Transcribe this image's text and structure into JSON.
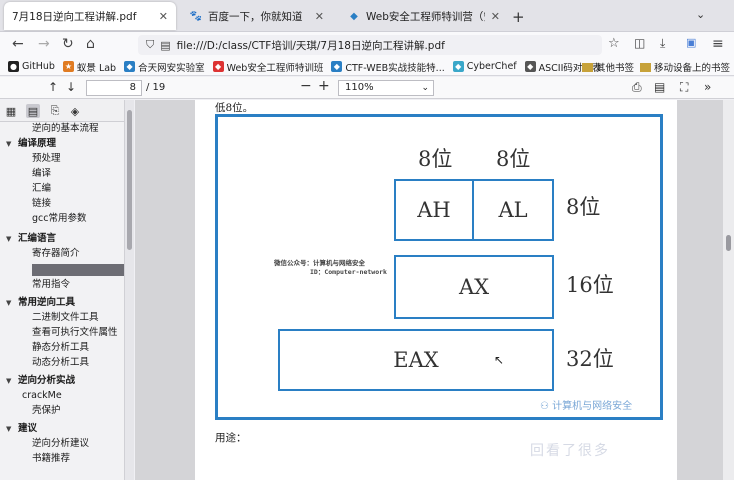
{
  "tabs": [
    {
      "title": "7月18日逆向工程讲解.pdf",
      "active": true
    },
    {
      "title": "百度一下，你就知道",
      "active": false
    },
    {
      "title": "Web安全工程师特训营（安全",
      "active": false
    }
  ],
  "nav": {
    "url": "file:///D:/class/CTF培训/天琪/7月18日逆向工程讲解.pdf"
  },
  "bookmarks": [
    "GitHub",
    "蚁景 Lab",
    "合天网安实验室",
    "Web安全工程师特训班",
    "CTF-WEB实战技能特...",
    "CyberChef",
    "ASCII码对照表"
  ],
  "bookmarks_right": [
    "其他书签",
    "移动设备上的书签"
  ],
  "pdf_toolbar": {
    "page_current": "8",
    "page_total": "/ 19",
    "zoom": "110%"
  },
  "outline": [
    {
      "label": "逆向的基本流程",
      "level": 2
    },
    {
      "label": "编译原理",
      "level": 1
    },
    {
      "label": "预处理",
      "level": 2
    },
    {
      "label": "编译",
      "level": 2
    },
    {
      "label": "汇编",
      "level": 2
    },
    {
      "label": "链接",
      "level": 2
    },
    {
      "label": "gcc常用参数",
      "level": 2
    },
    {
      "label": "汇编语言",
      "level": 1
    },
    {
      "label": "寄存器简介",
      "level": 2
    },
    {
      "label": "",
      "level": 2,
      "selected": true
    },
    {
      "label": "常用指令",
      "level": 2
    },
    {
      "label": "常用逆向工具",
      "level": 1
    },
    {
      "label": "二进制文件工具",
      "level": 2
    },
    {
      "label": "查看可执行文件属性",
      "level": 2
    },
    {
      "label": "静态分析工具",
      "level": 2
    },
    {
      "label": "动态分析工具",
      "level": 2
    },
    {
      "label": "逆向分析实战",
      "level": 1
    },
    {
      "label": "crackMe",
      "level": 2
    },
    {
      "label": "壳保护",
      "level": 2
    },
    {
      "label": "建议",
      "level": 1
    },
    {
      "label": "逆向分析建议",
      "level": 2
    },
    {
      "label": "书籍推荐",
      "level": 2
    }
  ],
  "document": {
    "top_caption": "低8位。",
    "bottom_caption": "用途：",
    "bit_labels": [
      "8位",
      "8位",
      "8位",
      "16位",
      "32位"
    ],
    "registers": {
      "ah": "AH",
      "al": "AL",
      "ax": "AX",
      "eax": "EAX"
    },
    "watermark_lines": [
      "微信公众号：计算机与网络安全",
      "ID：Computer-network"
    ],
    "watermark_corner": "计算机与网络安全",
    "accent_color": "#2a7fc4"
  },
  "overlay_text": "回看了很多"
}
